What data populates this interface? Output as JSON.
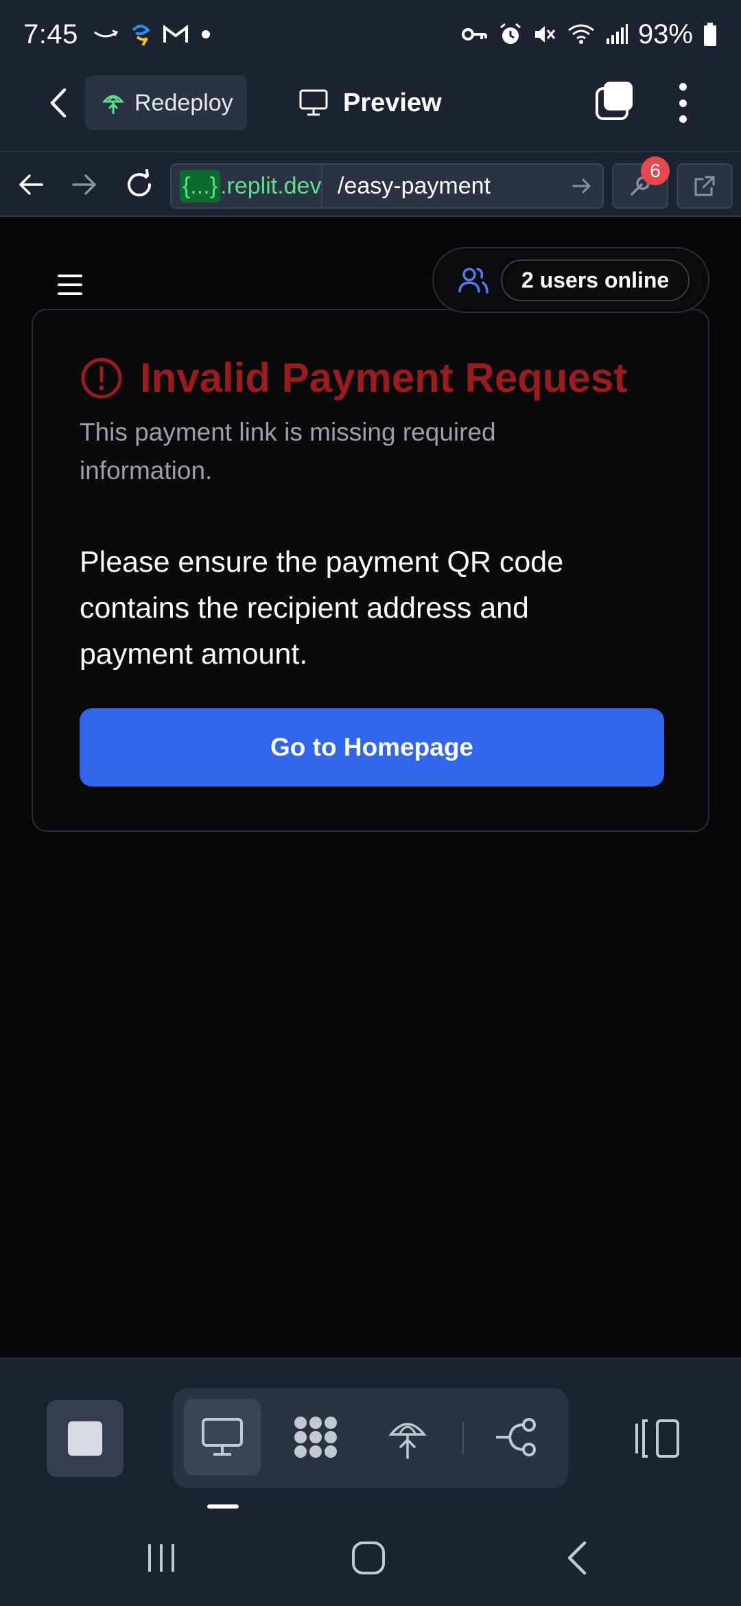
{
  "status_bar": {
    "time": "7:45",
    "battery_percent": "93%",
    "icons": [
      "amazon-icon",
      "app-icon",
      "gmail-icon",
      "dot-icon",
      "vpn-key-icon",
      "alarm-icon",
      "mute-icon",
      "wifi-icon",
      "signal-icon",
      "battery-icon"
    ]
  },
  "header": {
    "redeploy_label": "Redeploy",
    "preview_label": "Preview"
  },
  "url_bar": {
    "host_braces": "{...}",
    "host_domain": ".replit.dev",
    "path": "/easy-payment",
    "devtools_badge": "6"
  },
  "page": {
    "users_online": "2 users online",
    "error_title": "Invalid Payment Request",
    "error_subtitle": "This payment link is missing required information.",
    "error_body": "Please ensure the payment QR code contains the recipient address and payment amount.",
    "home_button": "Go to Homepage"
  },
  "colors": {
    "accent_blue": "#2f66eb",
    "error_red": "#9b1c1c",
    "url_green": "#5ce08a",
    "chrome_bg": "#1c2230"
  }
}
